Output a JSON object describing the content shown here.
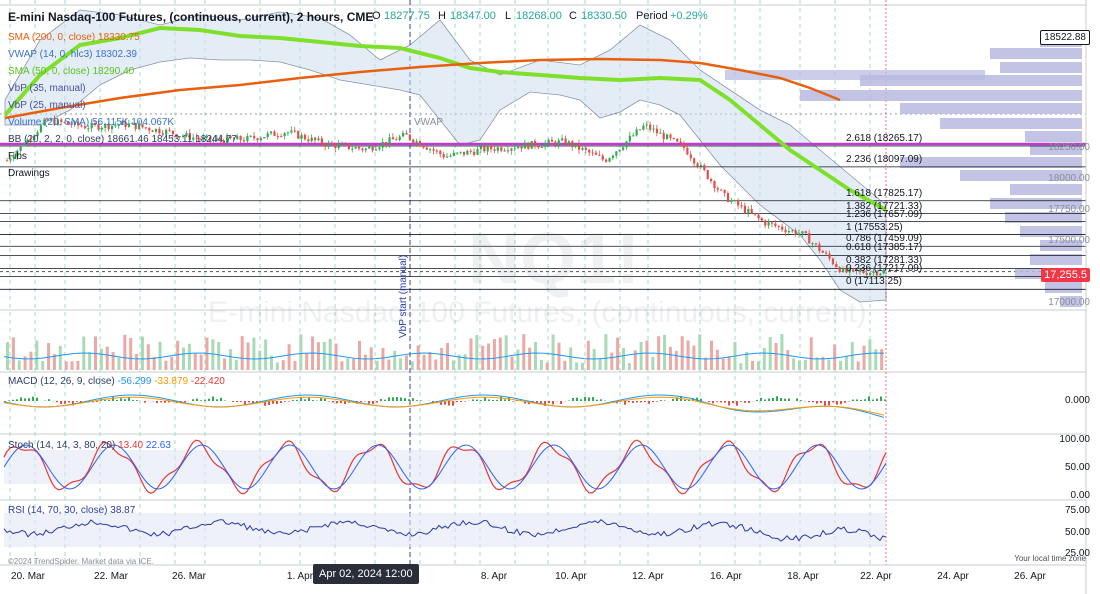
{
  "header": {
    "symbol_title": "E-mini Nasdaq-100 Futures, (continuous, current), 2 hours, CME",
    "o_label": "O",
    "o_value": "18277.75",
    "h_label": "H",
    "h_value": "18347.00",
    "l_label": "L",
    "l_value": "18268.00",
    "c_label": "C",
    "c_value": "18330.50",
    "period_label": "Period",
    "period_value": "+0.29%"
  },
  "indicators": {
    "sma200": {
      "label": "SMA (200, 0, close)",
      "value": "18330.75"
    },
    "vwap": {
      "label": "VWAP (14, 0, hlc3)",
      "value": "18302.39"
    },
    "sma50": {
      "label": "SMA (50, 0, close)",
      "value": "18290.40"
    },
    "vbp35": {
      "label": "VbP (35, manual)"
    },
    "vbp25": {
      "label": "VbP (25, manual)"
    },
    "volume": {
      "label": "Volume (20, SMA)",
      "value1": "56.115K",
      "value2": "104.067K"
    },
    "bb": {
      "label": "BB (20, 2, 2, 0, close)",
      "v1": "18661.46",
      "v2": "18453.11",
      "v3": "18244.77"
    },
    "fibs": "Fibs",
    "drawings": "Drawings",
    "macd": {
      "label": "MACD (12, 26, 9, close)",
      "v1": "-56.299",
      "v2": "-33.879",
      "v3": "-22.420"
    },
    "stoch": {
      "label": "Stoch (14, 14, 3, 80, 20)",
      "v1": "13.40",
      "v2": "22.63"
    },
    "rsi": {
      "label": "RSI (14, 70, 30, close)",
      "value": "38.87"
    }
  },
  "watermark": {
    "ticker": "NQ1!",
    "name": "E-mini Nasdaq-100 Futures, (continuous, current)"
  },
  "vwap_tag": "VWAP",
  "vbp_start_label": "VbP start (manual)",
  "fib_levels": [
    {
      "label": "2.618 (18265.17)",
      "price": 18265.17
    },
    {
      "label": "2.236 (18097.09)",
      "price": 18097.09
    },
    {
      "label": "1.618 (17825.17)",
      "price": 17825.17
    },
    {
      "label": "1.382 (17721.33)",
      "price": 17721.33
    },
    {
      "label": "1.236 (17657.09)",
      "price": 17657.09
    },
    {
      "label": "1 (17553.25)",
      "price": 17553.25
    },
    {
      "label": "0.786 (17459.09)",
      "price": 17459.09
    },
    {
      "label": "0.618 (17385.17)",
      "price": 17385.17
    },
    {
      "label": "0.382 (17281.33)",
      "price": 17281.33
    },
    {
      "label": "0.236 (17217.09)",
      "price": 17217.09
    },
    {
      "label": "0 (17113.25)",
      "price": 17113.25
    }
  ],
  "price_axis": {
    "ticks": [
      "18250.00",
      "18000.00",
      "17750.00",
      "17500.00",
      "17000.00"
    ],
    "tick_values": [
      18250,
      18000,
      17750,
      17500,
      17000
    ],
    "high_tag": "18522.88",
    "last_tag": "17,255.5",
    "high_price": 18522.88,
    "last_price": 17255.5
  },
  "macd_axis": {
    "tick": "0.000"
  },
  "stoch_axis": {
    "ticks": [
      "100.00",
      "50.00",
      "0.00"
    ]
  },
  "rsi_axis": {
    "ticks": [
      "75.00",
      "50.00",
      "25.00"
    ]
  },
  "x_axis": {
    "ticks": [
      "20. Mar",
      "22. Mar",
      "26. Mar",
      "1. Apr",
      "4. Apr",
      "8. Apr",
      "10. Apr",
      "12. Apr",
      "16. Apr",
      "18. Apr",
      "22. Apr",
      "24. Apr",
      "26. Apr"
    ],
    "crosshair_label": "Apr 02, 2024 12:00"
  },
  "footer": {
    "credit": "©2024 TrendSpider. Market data via ICE.",
    "timezone": "Your local time zone"
  },
  "colors": {
    "sma200": "#e8600c",
    "sma50": "#7ee02a",
    "vwap_magenta": "#c03ad0",
    "bb": "#9fb6cc",
    "bull": "#33a853",
    "bear": "#e0504a",
    "profile": "#b7b9e0",
    "macd_line": "#2196f3",
    "signal_line": "#ff9800",
    "stoch_k": "#2962ff",
    "stoch_d": "#e53935",
    "rsi": "#2a3aa8"
  },
  "chart_data": {
    "type": "candlestick",
    "title": "E-mini Nasdaq-100 Futures, (continuous, current), 2 hours, CME",
    "close_path": [
      {
        "x": "20. Mar",
        "y": 18150
      },
      {
        "x": "21. Mar",
        "y": 18470
      },
      {
        "x": "22. Mar",
        "y": 18420
      },
      {
        "x": "25. Mar",
        "y": 18440
      },
      {
        "x": "26. Mar",
        "y": 18380
      },
      {
        "x": "27. Mar",
        "y": 18310
      },
      {
        "x": "28. Mar",
        "y": 18320
      },
      {
        "x": "1. Apr",
        "y": 18380
      },
      {
        "x": "2. Apr",
        "y": 18280
      },
      {
        "x": "3. Apr",
        "y": 18240
      },
      {
        "x": "4. Apr",
        "y": 18350
      },
      {
        "x": "5. Apr",
        "y": 18180
      },
      {
        "x": "8. Apr",
        "y": 18240
      },
      {
        "x": "9. Apr",
        "y": 18270
      },
      {
        "x": "10. Apr",
        "y": 18300
      },
      {
        "x": "11. Apr",
        "y": 18150
      },
      {
        "x": "12. Apr",
        "y": 18430
      },
      {
        "x": "15. Apr",
        "y": 18250
      },
      {
        "x": "16. Apr",
        "y": 17860
      },
      {
        "x": "17. Apr",
        "y": 17650
      },
      {
        "x": "18. Apr",
        "y": 17550
      },
      {
        "x": "19. Apr",
        "y": 17250
      },
      {
        "x": "22. Apr",
        "y": 17255.5
      }
    ],
    "ylim": [
      16900,
      18550
    ]
  }
}
